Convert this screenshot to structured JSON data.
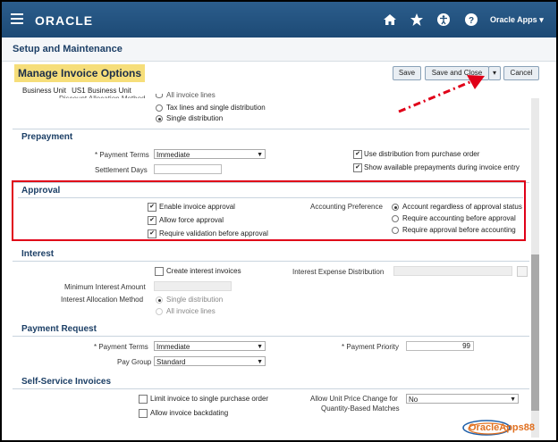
{
  "app": {
    "brand": "ORACLE",
    "apps_menu": "Oracle Apps"
  },
  "subheader": {
    "title": "Setup and Maintenance"
  },
  "page": {
    "title": "Manage Invoice Options",
    "buttons": {
      "save": "Save",
      "save_close": "Save and Close",
      "cancel": "Cancel"
    },
    "business_unit_label": "Business Unit",
    "business_unit_value": "US1 Business Unit"
  },
  "distribution": {
    "partial_label": "Discount Allocation Method",
    "options": [
      "All invoice lines",
      "Tax lines and single distribution",
      "Single distribution"
    ],
    "selected": "Single distribution"
  },
  "prepayment": {
    "heading": "Prepayment",
    "payment_terms_label": "* Payment Terms",
    "payment_terms_value": "Immediate",
    "settlement_days_label": "Settlement Days",
    "use_dist_label": "Use distribution from purchase order",
    "show_prepay_label": "Show available prepayments during invoice entry"
  },
  "approval": {
    "heading": "Approval",
    "enable_label": "Enable invoice approval",
    "force_label": "Allow force approval",
    "require_label": "Require validation before approval",
    "acct_pref_label": "Accounting Preference",
    "acct_options": [
      "Account regardless of approval status",
      "Require accounting before approval",
      "Require approval before accounting"
    ],
    "acct_selected": "Account regardless of approval status"
  },
  "interest": {
    "heading": "Interest",
    "create_label": "Create interest invoices",
    "min_amount_label": "Minimum Interest Amount",
    "alloc_method_label": "Interest Allocation Method",
    "alloc_options": [
      "Single distribution",
      "All invoice lines"
    ],
    "expense_dist_label": "Interest Expense Distribution"
  },
  "payment_request": {
    "heading": "Payment Request",
    "payment_terms_label": "* Payment Terms",
    "payment_terms_value": "Immediate",
    "pay_group_label": "Pay Group",
    "pay_group_value": "Standard",
    "priority_label": "* Payment Priority",
    "priority_value": "99"
  },
  "self_service": {
    "heading": "Self-Service Invoices",
    "limit_label": "Limit invoice to single purchase order",
    "backdate_label": "Allow invoice backdating",
    "unit_price_label_1": "Allow Unit Price Change for",
    "unit_price_label_2": "Quantity-Based Matches",
    "unit_price_value": "No"
  },
  "watermark": {
    "text": "OracleApps88"
  },
  "colors": {
    "header": "#1f4e79",
    "highlight": "#f6de7a",
    "annotation": "#e00018"
  }
}
